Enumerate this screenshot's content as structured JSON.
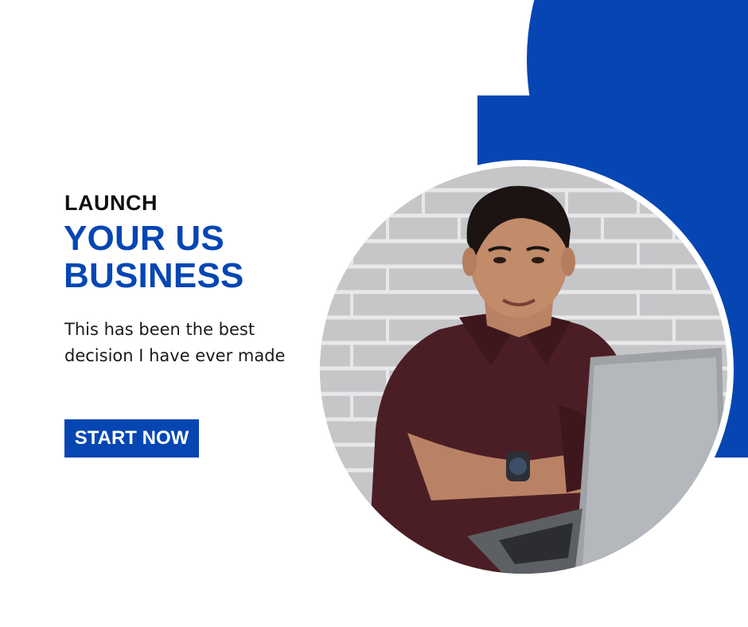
{
  "hero": {
    "eyebrow": "LAUNCH",
    "headline": "YOUR US BUSINESS",
    "tagline": "This has been the best decision I have ever made",
    "cta_label": "START NOW"
  },
  "colors": {
    "brand_blue": "#0546b3",
    "background": "#ffffff",
    "text_dark": "#111111"
  },
  "photo": {
    "subject": "smiling man with crossed arms at a laptop in front of a white brick wall"
  }
}
